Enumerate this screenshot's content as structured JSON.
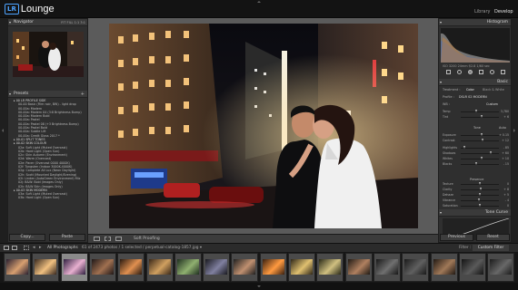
{
  "app": {
    "logo_box": "LR",
    "logo_word": "Lounge"
  },
  "modules": [
    {
      "label": "Library",
      "active": false
    },
    {
      "label": "Develop",
      "active": true
    }
  ],
  "navigator": {
    "title": "Navigator",
    "zoom": "FIT  FILL  1:1  3:1"
  },
  "presets": {
    "title": "Presets",
    "items": [
      {
        "label": "00 LR PROFILE SIDE",
        "folder": true
      },
      {
        "label": "00-00 Basic (Film noir, BW) - light drop",
        "folder": false
      },
      {
        "label": "00-00a: Modern",
        "folder": false
      },
      {
        "label": "00-00a: Modern 04 (3:8 Brightness Bump)",
        "folder": false
      },
      {
        "label": "00-00a: Modern Bold",
        "folder": false
      },
      {
        "label": "00-00a: Pastel",
        "folder": false
      },
      {
        "label": "00-00a: Pastel 08 (+3 Brightness Bump)",
        "folder": false
      },
      {
        "label": "00-00a: Pastel Bold",
        "folder": false
      },
      {
        "label": "00-00a: Subtle Lift",
        "folder": false
      },
      {
        "label": "00-00a: Credit Gloss 2017 *",
        "folder": false
      },
      {
        "label": "00-01 SPLIT TONES",
        "folder": true
      },
      {
        "label": "00-02 SKIN COLOUR",
        "folder": true
      },
      {
        "label": "02a: Soft Light (Muted Overcast)",
        "folder": false
      },
      {
        "label": "02b: Hard Light (Open Sun)",
        "folder": false
      },
      {
        "label": "02c: Skin Autumn (Environment)",
        "folder": false
      },
      {
        "label": "02d: Warm (Overcast)",
        "folder": false
      },
      {
        "label": "02e: Pacer (Overcast 0000 4000K)",
        "folder": false
      },
      {
        "label": "02f: Tungsten (Indoor 3000K-4000K)",
        "folder": false
      },
      {
        "label": "02g: Complete All Lux (Neon Daylight)",
        "folder": false
      },
      {
        "label": "02h: Scott (Mounted Daylight/Evening)",
        "folder": false
      },
      {
        "label": "02i: Linden (AutoGreen Environment) Mix",
        "folder": false
      },
      {
        "label": "02j: B&W: Bold (Images Only)",
        "folder": false
      },
      {
        "label": "02k: B&W Skin (Images Only)",
        "folder": false
      },
      {
        "label": "00-03 SKIN MODERN",
        "folder": true
      },
      {
        "label": "03a: Soft Light (Muted Overcast)",
        "folder": false
      },
      {
        "label": "03b: Hard Light (Open Sun)",
        "folder": false
      }
    ],
    "copy_btn": "Copy...",
    "paste_btn": "Paste"
  },
  "toolbar": {
    "soft_proofing": "Soft Proofing"
  },
  "histogram": {
    "title": "Histogram",
    "info": "ISO 3200   24mm   f/2.8   1/60 sec"
  },
  "basic": {
    "title": "Basic",
    "treatment_label": "Treatment :",
    "treatment_color": "Color",
    "treatment_bw": "Black & White",
    "profile_label": "Profile :",
    "profile_value": "DSLR 02 MODERN",
    "wb_label": "WB :",
    "wb_value": "Custom",
    "sliders": [
      {
        "label": "Temp",
        "value": "3,780",
        "pos": 0.42
      },
      {
        "label": "Tint",
        "value": "+ 6",
        "pos": 0.55
      },
      {
        "label": "Exposure",
        "value": "+ 0.15",
        "pos": 0.55
      },
      {
        "label": "Contrast",
        "value": "+ 12",
        "pos": 0.58
      },
      {
        "label": "Highlights",
        "value": "- 85",
        "pos": 0.1
      },
      {
        "label": "Shadows",
        "value": "+ 60",
        "pos": 0.8
      },
      {
        "label": "Whites",
        "value": "+ 10",
        "pos": 0.55
      },
      {
        "label": "Blacks",
        "value": "- 15",
        "pos": 0.42
      },
      {
        "label": "Texture",
        "value": "0",
        "pos": 0.5
      },
      {
        "label": "Clarity",
        "value": "+ 8",
        "pos": 0.54
      },
      {
        "label": "Dehaze",
        "value": "+ 5",
        "pos": 0.52
      },
      {
        "label": "Vibrance",
        "value": "- 4",
        "pos": 0.48
      },
      {
        "label": "Saturation",
        "value": "0",
        "pos": 0.5
      }
    ],
    "auto_label": "Auto",
    "tone_label": "Tone",
    "presence_label": "Presence"
  },
  "tone_curve": {
    "title": "Tone Curve"
  },
  "right_buttons": {
    "previous": "Previous",
    "reset": "Reset"
  },
  "filmbar": {
    "source": "All Photographs",
    "count": "61 of 2473 photos / 1 selected / perpetual-catalog-1857.jpg ▾",
    "filter_label": "Filter :",
    "filter_value": "Custom Filter"
  },
  "filmstrip": {
    "cells": 18,
    "selected_index": 2
  }
}
